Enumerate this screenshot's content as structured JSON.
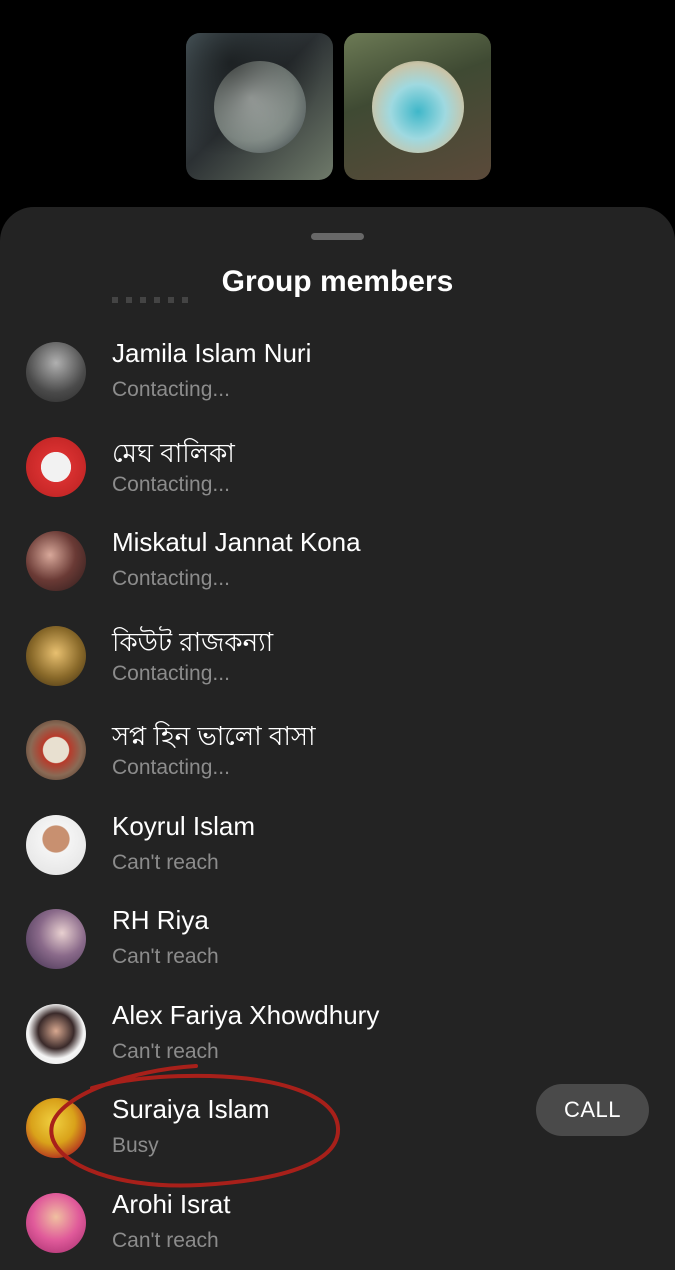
{
  "header": {
    "title": "Group members"
  },
  "call_button": {
    "label": "CALL"
  },
  "members": [
    {
      "name": "Jamila Islam Nuri",
      "status": "Contacting...",
      "avatar_color": "#6a6a6a"
    },
    {
      "name": "মেঘ বালিকা",
      "status": "Contacting...",
      "avatar_color": "#c23a3a"
    },
    {
      "name": "Miskatul Jannat Kona",
      "status": "Contacting...",
      "avatar_color": "#5a2a28"
    },
    {
      "name": "কিউট রাজকন্যা",
      "status": "Contacting...",
      "avatar_color": "#7a6a2a"
    },
    {
      "name": "সপ্ন হিন ভালো বাসা",
      "status": "Contacting...",
      "avatar_color": "#8a6a55"
    },
    {
      "name": "Koyrul Islam",
      "status": "Can't reach",
      "avatar_color": "#e8e8e8"
    },
    {
      "name": "RH Riya",
      "status": "Can't reach",
      "avatar_color": "#5a4a6a"
    },
    {
      "name": "Alex Fariya Xhowdhury",
      "status": "Can't reach",
      "avatar_color": "#f0f0f0"
    },
    {
      "name": "Suraiya Islam",
      "status": "Busy",
      "avatar_color": "#d9a21a",
      "has_call_button": true
    },
    {
      "name": "Arohi Israt",
      "status": "Can't reach",
      "avatar_color": "#d64a8a"
    }
  ],
  "colors": {
    "sheet_bg": "#232323",
    "secondary_text": "#8c8c8c",
    "call_button_bg": "#4a4a4a",
    "annotation_red": "#a8201a"
  }
}
